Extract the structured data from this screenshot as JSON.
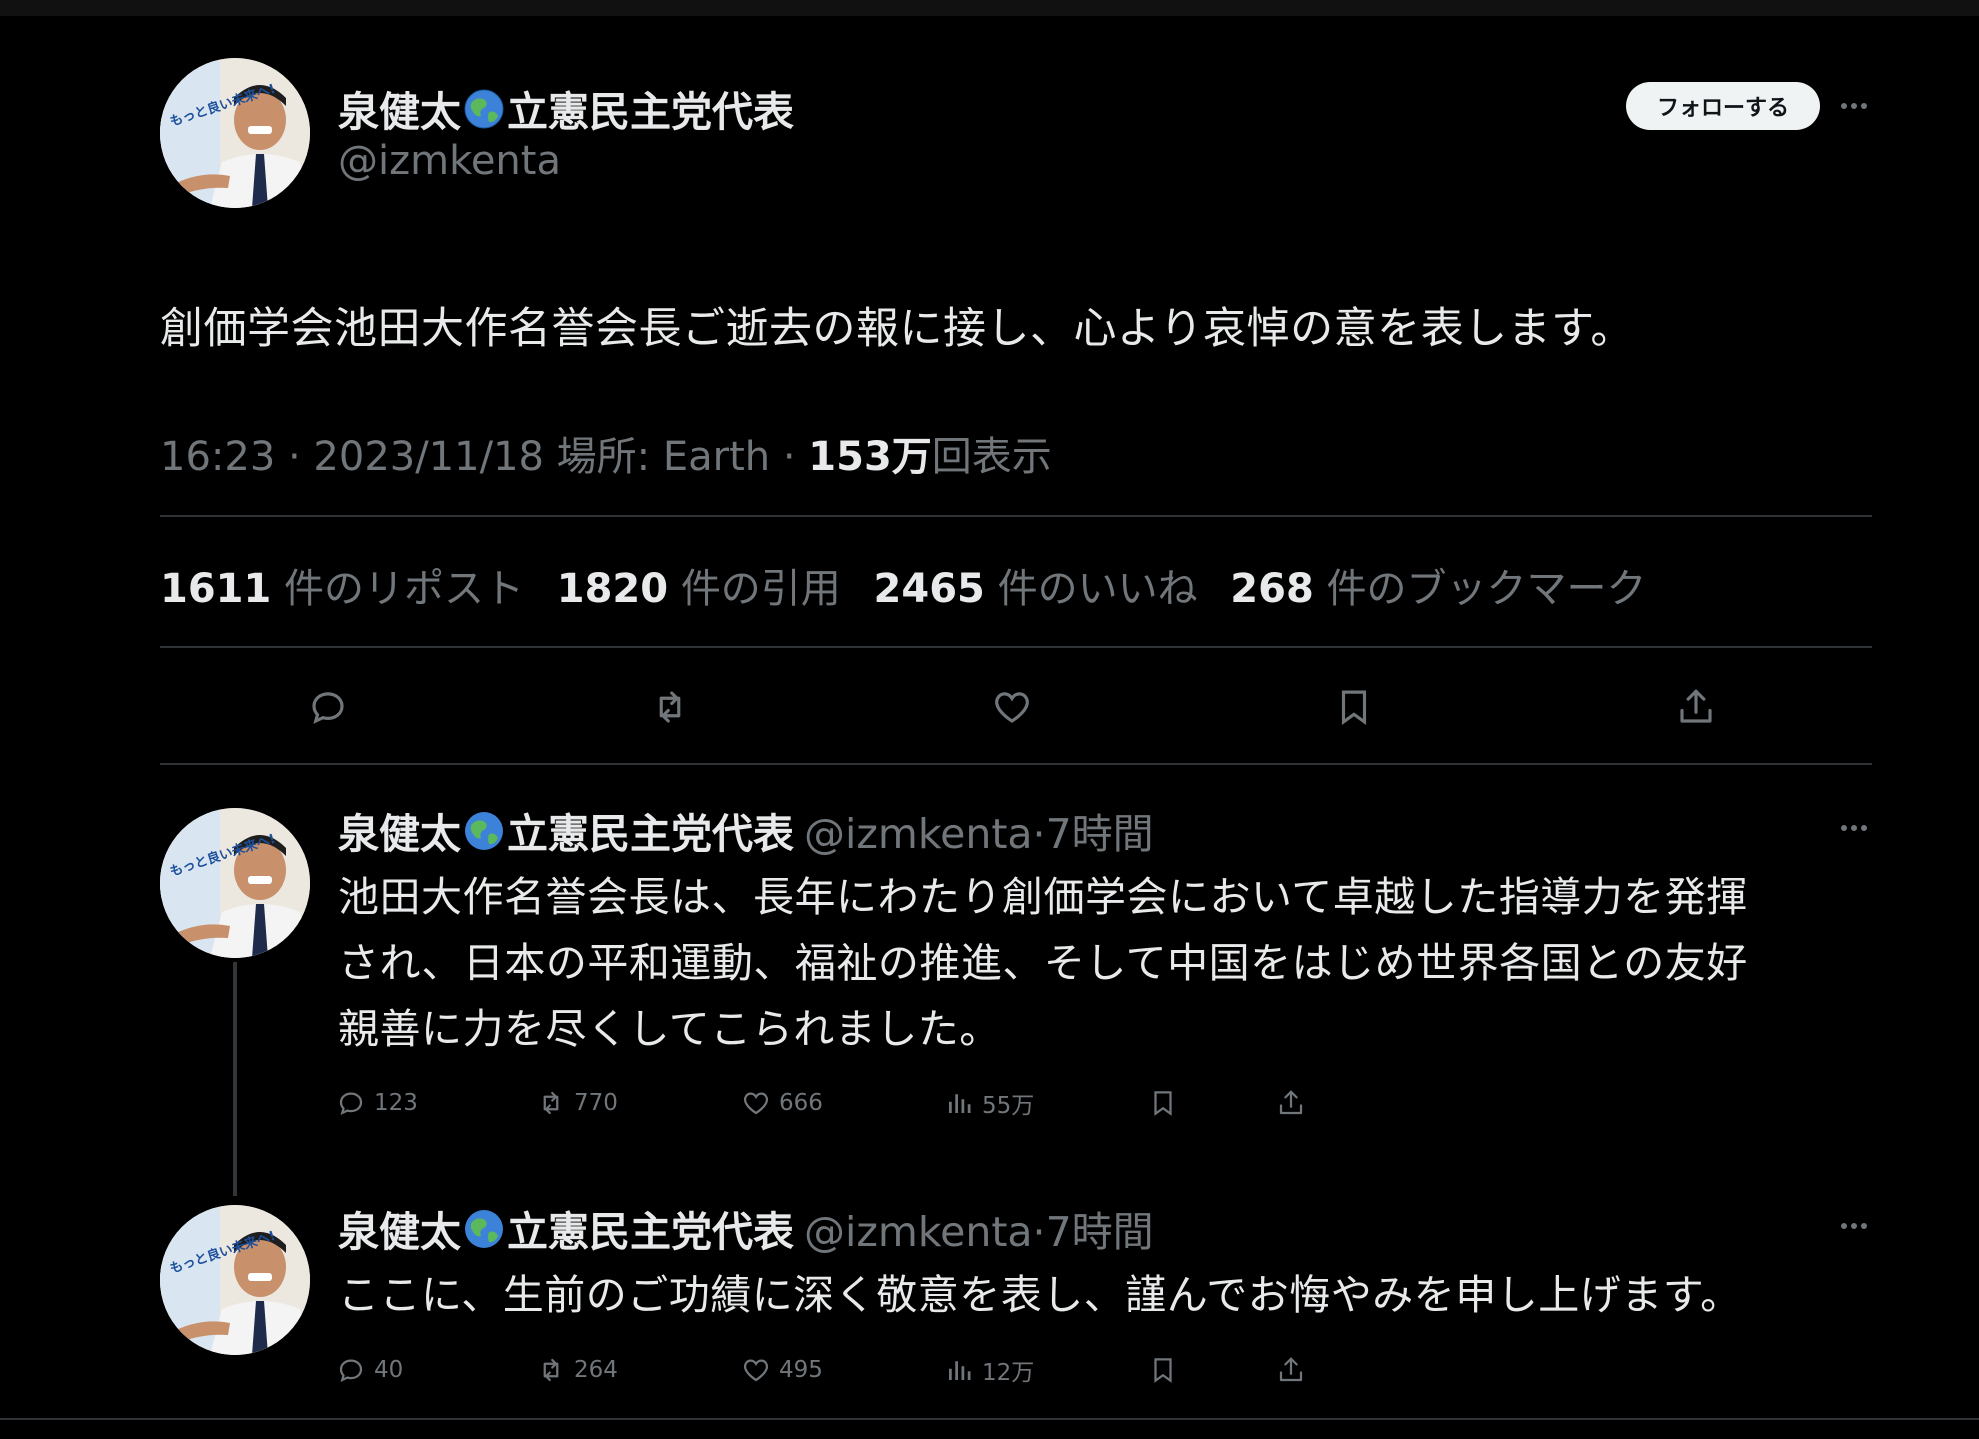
{
  "tweet": {
    "author_name_before": "泉健太",
    "author_name_after": "立憲民主党代表",
    "handle": "@izmkenta",
    "follow_label": "フォローする",
    "text": "創価学会池田大作名誉会長ご逝去の報に接し、心より哀悼の意を表します。",
    "meta_time": "16:23 · 2023/11/18 場所: Earth · ",
    "meta_views_num": "153万",
    "meta_views_label": "回表示",
    "stats": [
      {
        "num": "1611",
        "label": "件のリポスト"
      },
      {
        "num": "1820",
        "label": "件の引用"
      },
      {
        "num": "2465",
        "label": "件のいいね"
      },
      {
        "num": "268",
        "label": "件のブックマーク"
      }
    ],
    "actions": [
      "reply-icon",
      "repost-icon",
      "like-icon",
      "bookmark-icon",
      "share-icon"
    ]
  },
  "replies": [
    {
      "name_before": "泉健太",
      "name_after": "立憲民主党代表",
      "handle": "@izmkenta",
      "time": "·7時間",
      "lines": [
        "池田大作名誉会長は、長年にわたり創価学会において卓越した指導力を発揮",
        "され、日本の平和運動、福祉の推進、そして中国をはじめ世界各国との友好",
        "親善に力を尽くしてこられました。"
      ],
      "reply_count": "123",
      "repost_count": "770",
      "like_count": "666",
      "view_count": "55万"
    },
    {
      "name_before": "泉健太",
      "name_after": "立憲民主党代表",
      "handle": "@izmkenta",
      "time": "·7時間",
      "lines": [
        "ここに、生前のご功績に深く敬意を表し、謹んでお悔やみを申し上げます。"
      ],
      "reply_count": "40",
      "repost_count": "264",
      "like_count": "495",
      "view_count": "12万"
    }
  ],
  "avatar_banner_text": "もっと良い未来へ!",
  "colors": {
    "background": "#000000",
    "text": "#e7e9ea",
    "muted": "#71767b",
    "divider": "#2f3336",
    "follow_bg": "#eff3f4"
  }
}
